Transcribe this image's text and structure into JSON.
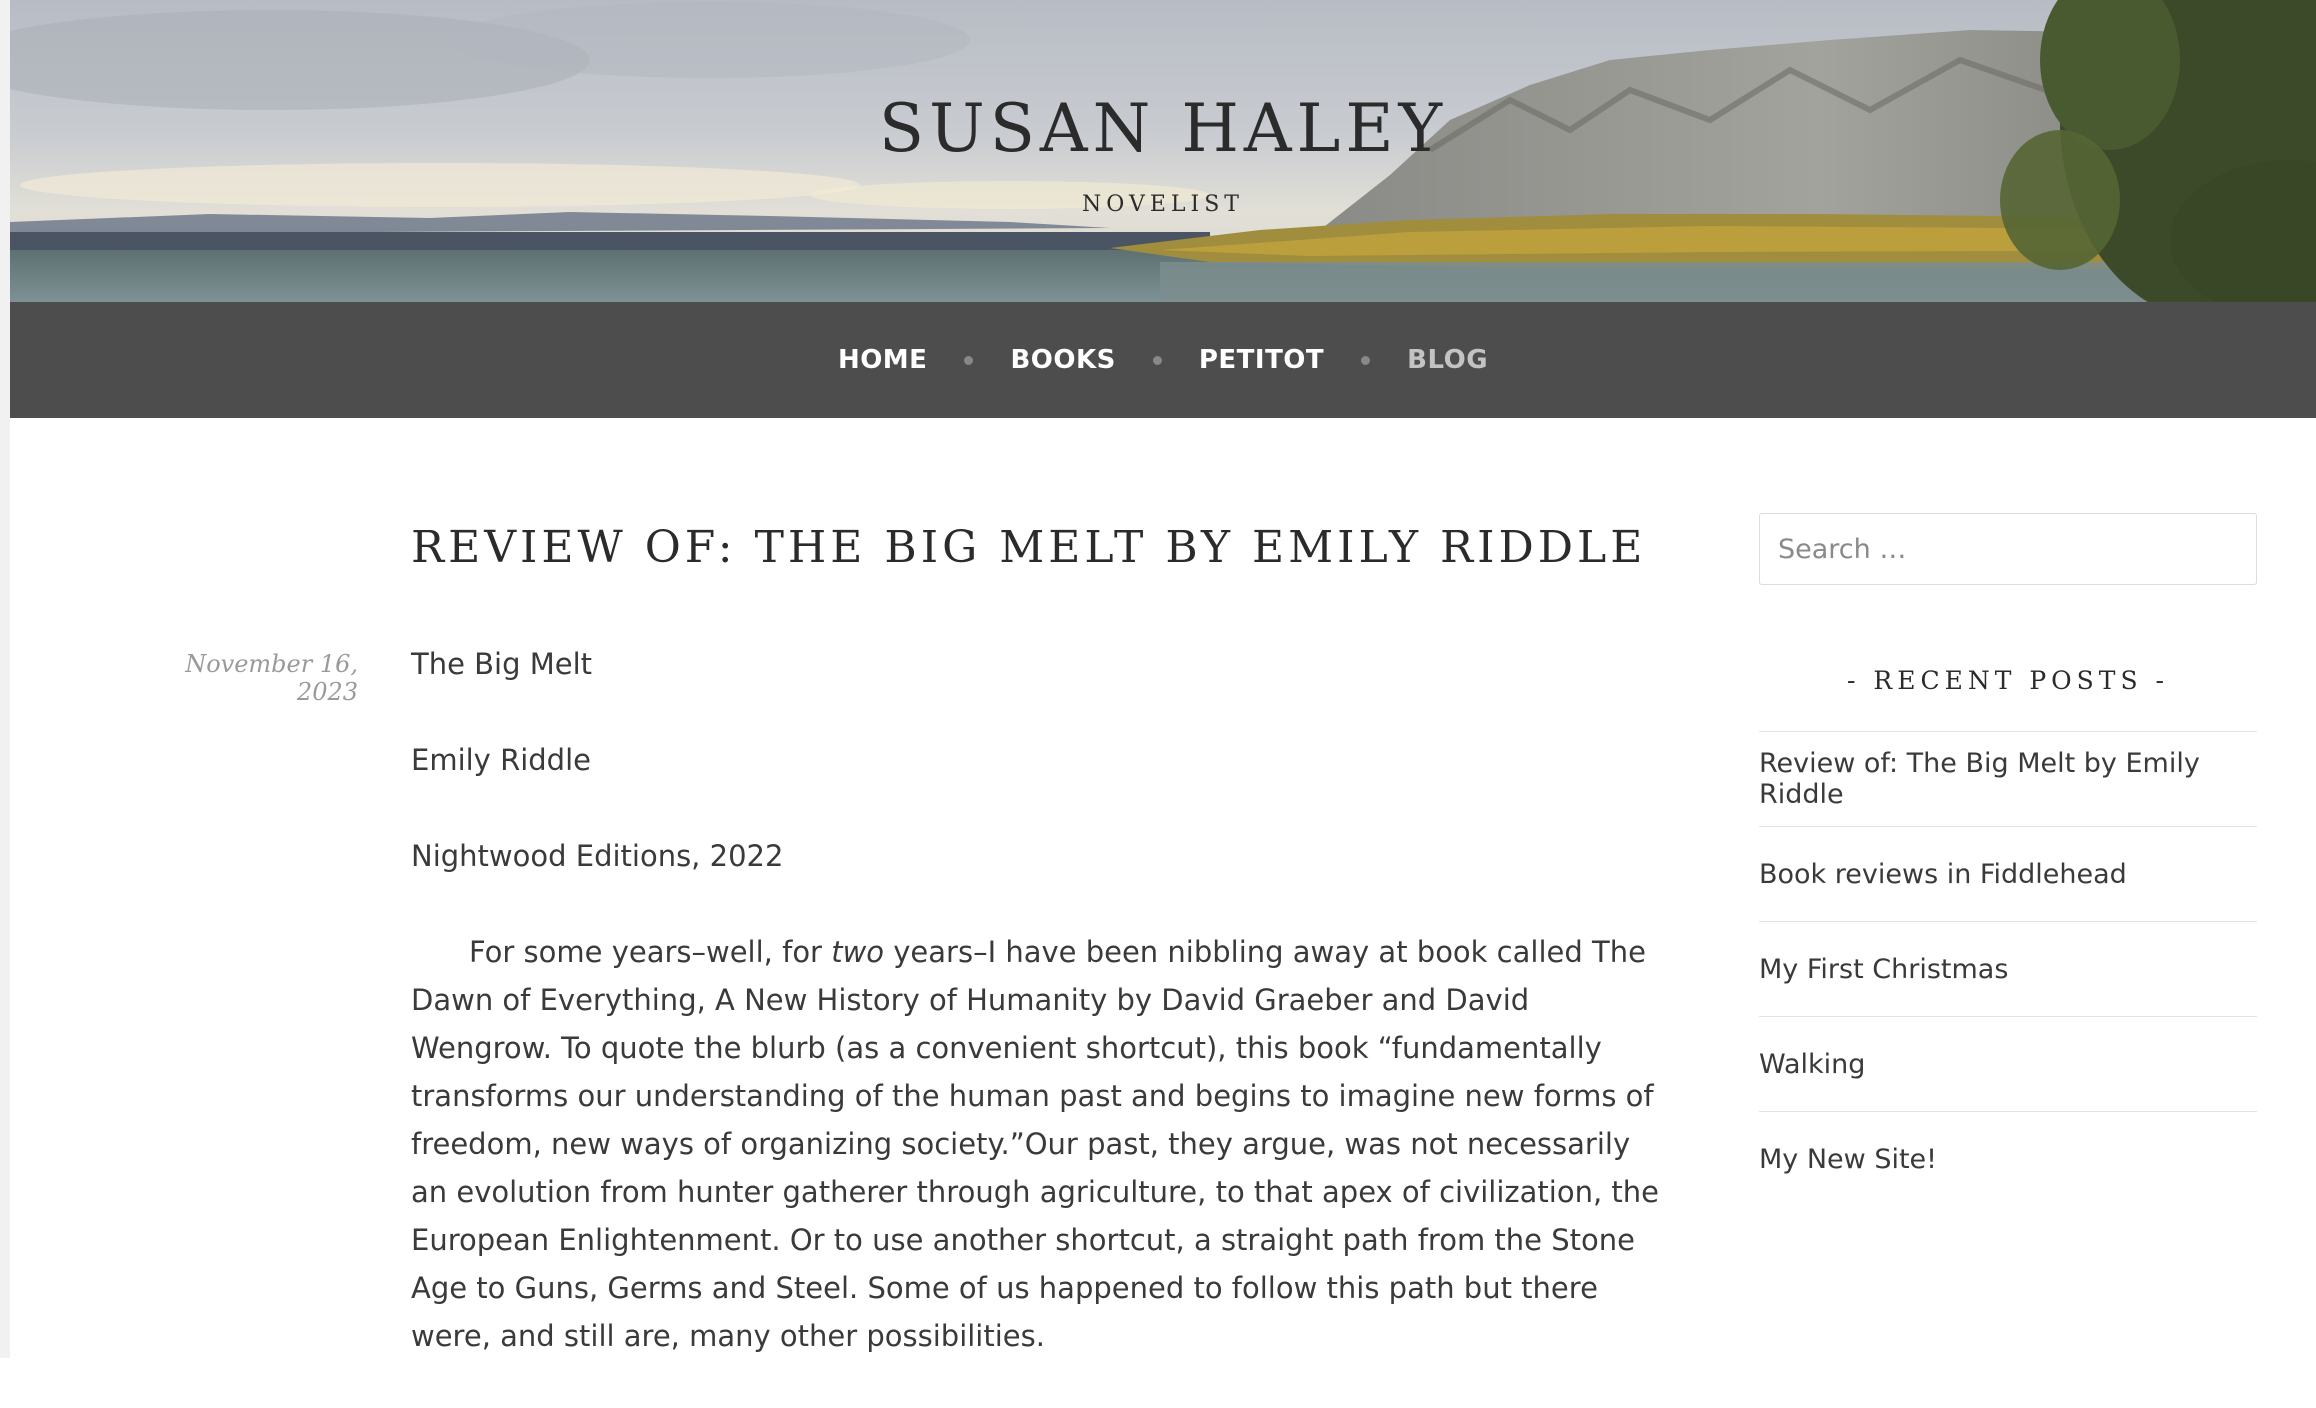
{
  "site": {
    "title": "SUSAN HALEY",
    "tagline": "NOVELIST"
  },
  "nav": {
    "items": [
      {
        "label": "HOME",
        "current": false
      },
      {
        "label": "BOOKS",
        "current": false
      },
      {
        "label": "PETITOT",
        "current": false
      },
      {
        "label": "BLOG",
        "current": true
      }
    ]
  },
  "post": {
    "title": "REVIEW OF: THE BIG MELT BY EMILY RIDDLE",
    "date": "November 16, 2023",
    "book_title": "The Big Melt",
    "author": "Emily Riddle",
    "publisher": "Nightwood Editions, 2022",
    "paragraph_before_em": "For some years–well, for ",
    "paragraph_em": "two",
    "paragraph_after_em": " years–I have been nibbling away at book called The Dawn of Everything, A New History of Humanity by David Graeber and David Wengrow. To quote the blurb (as a convenient shortcut), this book “fundamentally transforms our understanding of the human past and begins to imagine new forms of freedom, new ways of organizing society.”Our past, they argue, was not necessarily an evolution from hunter gatherer through agriculture, to that apex of civilization, the European Enlightenment. Or to use another shortcut, a straight path from the Stone Age to Guns, Germs and Steel. Some of us happened to follow this path but there were, and still are, many other possibilities."
  },
  "sidebar": {
    "search": {
      "placeholder": "Search …",
      "value": ""
    },
    "recent_posts": {
      "title": "- RECENT POSTS -",
      "items": [
        "Review of: The Big Melt by Emily Riddle",
        "Book reviews in Fiddlehead",
        "My First Christmas",
        "Walking",
        "My New Site!"
      ]
    }
  },
  "colors": {
    "nav_background": "#4d4d4d",
    "nav_text": "#ffffff",
    "nav_current": "#c3c3c3",
    "date_text": "#9a9a9a",
    "body_text": "#3a3a3a"
  }
}
